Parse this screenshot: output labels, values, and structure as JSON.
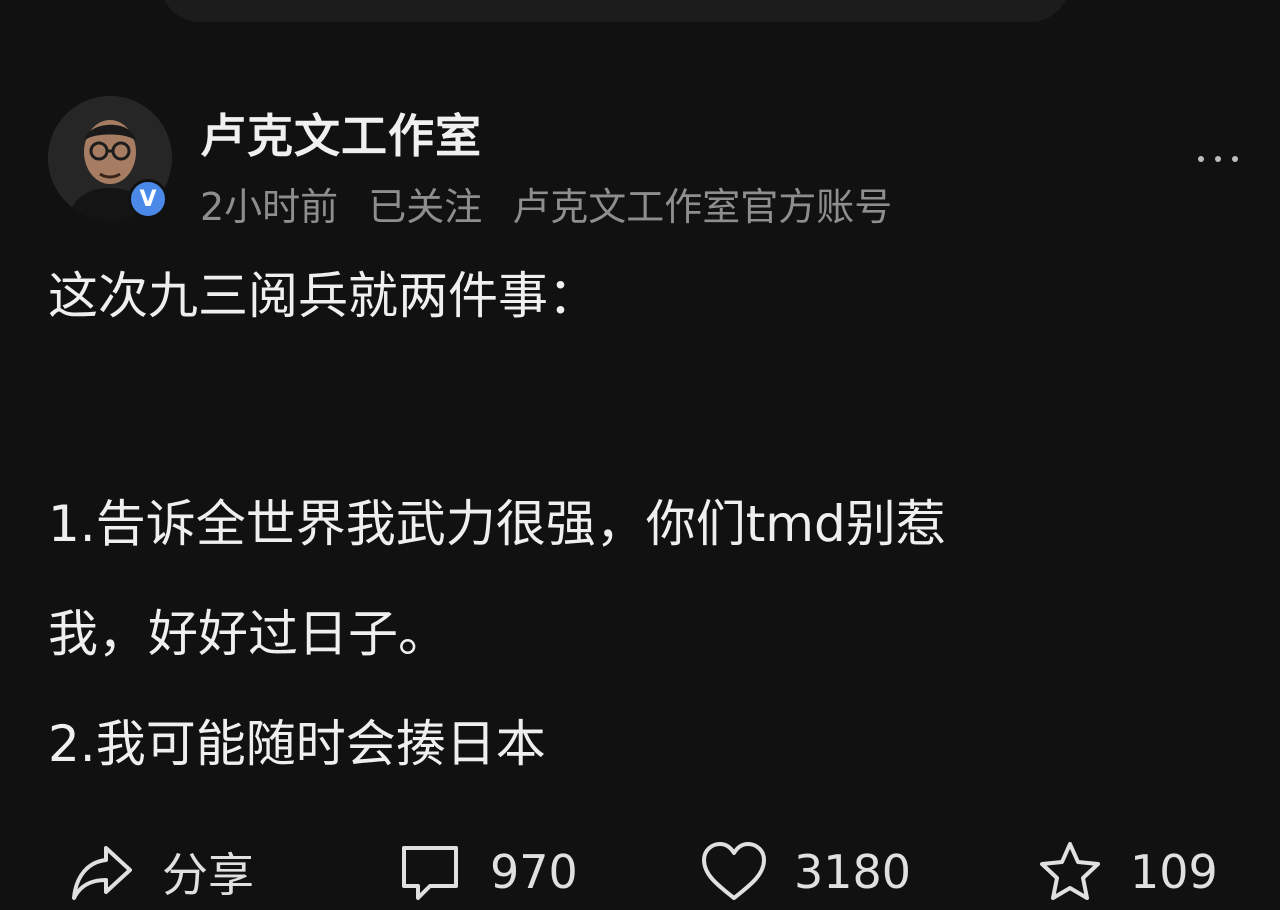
{
  "author": {
    "name": "卢克文工作室",
    "verified_mark": "V",
    "time": "2小时前",
    "follow_status": "已关注",
    "description": "卢克文工作室官方账号",
    "avatar_icon": "user-avatar-photo"
  },
  "post": {
    "intro": "这次九三阅兵就两件事：",
    "point1_line1": "1.告诉全世界我武力很强，你们tmd别惹",
    "point1_line2": "我，好好过日子。",
    "point2": "2.我可能随时会揍日本"
  },
  "actions": {
    "share_label": "分享",
    "comment_count": "970",
    "like_count": "3180",
    "favorite_count": "109"
  },
  "colors": {
    "background": "#111111",
    "verified": "#4a89e8",
    "meta_text": "#8e8e8e"
  }
}
